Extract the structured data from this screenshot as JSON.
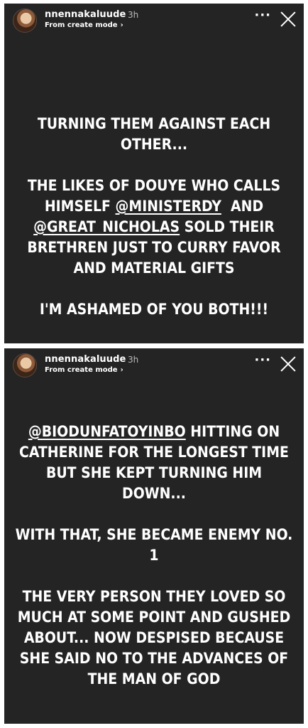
{
  "stories": [
    {
      "username": "nnennakaluude",
      "time": "3h",
      "mode_label": "From create mode",
      "more_icon": "more-dots-icon",
      "close_icon": "close-icon",
      "lines": {
        "l1": "TURNING THEM AGAINST EACH",
        "l2": "OTHER...",
        "l3": "THE LIKES OF DOUYE WHO CALLS",
        "l4a": "HIMSELF ",
        "l4m": "@MINISTERDY",
        "l4b": "  AND",
        "l5m": "@GREAT_NICHOLAS",
        "l5b": " SOLD THEIR",
        "l6": "BRETHREN JUST TO CURRY FAVOR",
        "l7": "AND MATERIAL GIFTS",
        "l8": "I'M ASHAMED OF YOU BOTH!!!"
      }
    },
    {
      "username": "nnennakaluude",
      "time": "3h",
      "mode_label": "From create mode",
      "more_icon": "more-dots-icon",
      "close_icon": "close-icon",
      "lines": {
        "l1m": "@BIODUNFATOYINBO",
        "l1b": " HITTING ON",
        "l2": "CATHERINE FOR THE LONGEST TIME",
        "l3": "BUT SHE KEPT TURNING HIM",
        "l4": "DOWN...",
        "l5": "WITH THAT, SHE BECAME ENEMY NO.",
        "l6": "1",
        "l7": "THE VERY PERSON THEY LOVED SO",
        "l8": "MUCH AT SOME POINT AND GUSHED",
        "l9": "ABOUT... NOW DESPISED BECAUSE",
        "l10": "SHE SAID NO TO THE ADVANCES OF",
        "l11": "THE MAN OF GOD"
      }
    }
  ]
}
